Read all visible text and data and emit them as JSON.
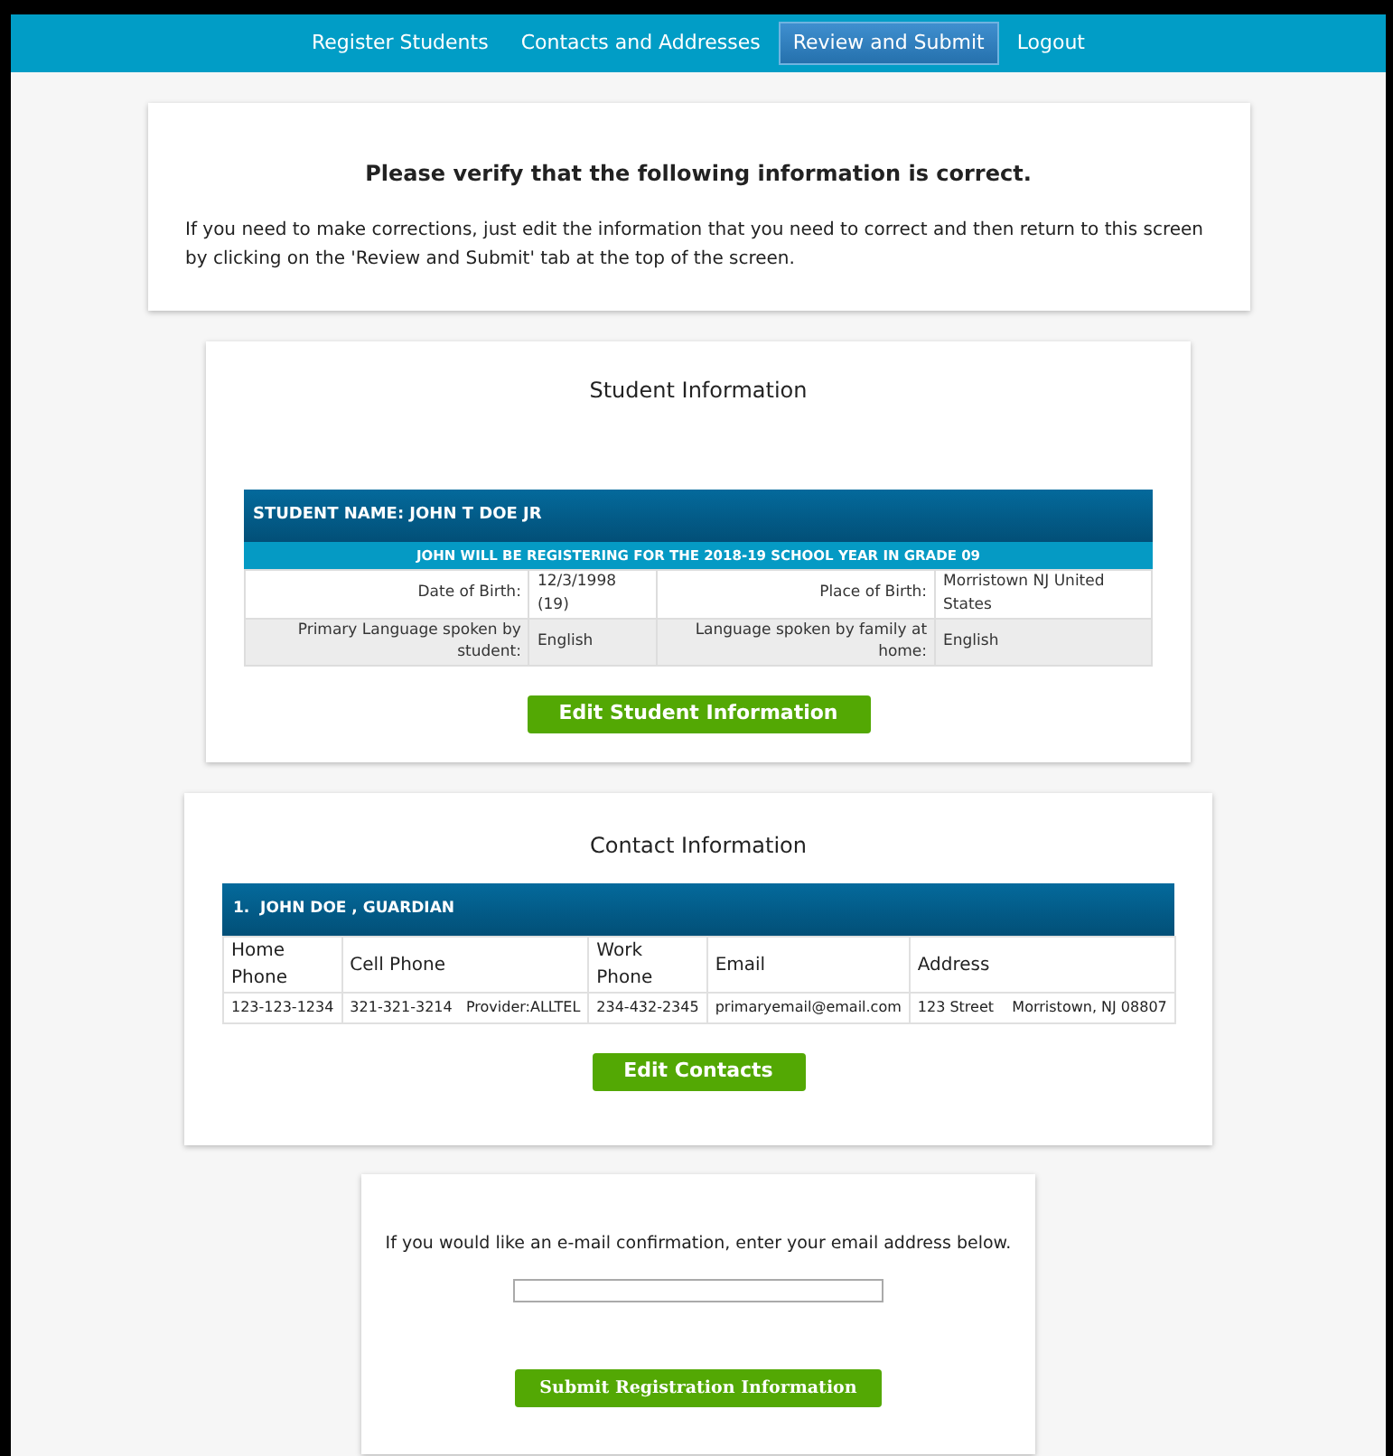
{
  "nav": [
    {
      "label": "Register Students",
      "selected": false
    },
    {
      "label": "Contacts and Addresses",
      "selected": false
    },
    {
      "label": "Review and Submit",
      "selected": true
    },
    {
      "label": "Logout",
      "selected": false
    }
  ],
  "verify": {
    "title": "Please verify that the following information is correct.",
    "text": "If you need to make corrections, just edit the information that you need to correct and then return to this screen by clicking on the 'Review and Submit' tab at the top of the screen."
  },
  "student": {
    "title": "Student Information",
    "name": "STUDENT NAME: JOHN T DOE JR",
    "banner": "JOHN WILL BE REGISTERING FOR THE 2018-19 SCHOOL YEAR IN GRADE 09",
    "rows": [
      [
        "Date of Birth:",
        "12/3/1998 (19)",
        "Place of Birth:",
        "Morristown NJ United States"
      ],
      [
        "Primary Language spoken by student:",
        "English",
        "Language spoken by family at home:",
        "English"
      ]
    ],
    "button": "Edit Student Information"
  },
  "contacts": {
    "title": "Contact Information",
    "header": "1.  JOHN DOE , GUARDIAN",
    "columns": [
      "Home Phone",
      "Cell Phone",
      "Work Phone",
      "Email",
      "Address"
    ],
    "row": [
      "123-123-1234",
      "321-321-3214   Provider:ALLTEL",
      "234-432-2345",
      "primaryemail@email.com",
      "123 Street    Morristown, NJ 08807"
    ],
    "button": "Edit Contacts"
  },
  "confirm": {
    "text": "If you would like an e-mail confirmation, enter your email address below.",
    "button": "Submit Registration Information"
  }
}
